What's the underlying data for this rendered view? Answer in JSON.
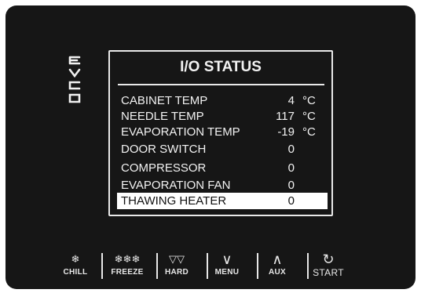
{
  "brand": {
    "logo_text": "EVCO",
    "logo_icon": "evco-logo-icon"
  },
  "screen": {
    "title": "I/O STATUS",
    "rows": [
      {
        "label": "CABINET TEMP",
        "value": "4",
        "unit": "°C",
        "selected": false
      },
      {
        "label": "NEEDLE TEMP",
        "value": "117",
        "unit": "°C",
        "selected": false
      },
      {
        "label": "EVAPORATION TEMP",
        "value": "-19",
        "unit": "°C",
        "selected": false
      },
      {
        "label": "DOOR SWITCH",
        "value": "0",
        "unit": "",
        "selected": false
      },
      {
        "label": "COMPRESSOR",
        "value": "0",
        "unit": "",
        "selected": false
      },
      {
        "label": "EVAPORATION FAN",
        "value": "0",
        "unit": "",
        "selected": false
      },
      {
        "label": "THAWING HEATER",
        "value": "0",
        "unit": "",
        "selected": true
      }
    ]
  },
  "keys": {
    "chill": {
      "label": "CHILL",
      "icon": "snowflake-icon",
      "glyph": "❄"
    },
    "freeze": {
      "label": "FREEZE",
      "icon": "triple-snowflake-icon",
      "glyph": "❄❄❄"
    },
    "hard": {
      "label": "HARD",
      "icon": "double-triangle-down-icon",
      "glyph": "▽▽"
    },
    "menu": {
      "label": "MENU",
      "icon": "chevron-down-icon",
      "glyph": "∨"
    },
    "aux": {
      "label": "AUX",
      "icon": "chevron-up-icon",
      "glyph": "∧"
    },
    "start": {
      "label": "START",
      "icon": "restart-icon",
      "glyph": "↻"
    }
  },
  "colors": {
    "panel": "#161616",
    "text": "#f2f2f2",
    "highlight": "#ffffff"
  }
}
